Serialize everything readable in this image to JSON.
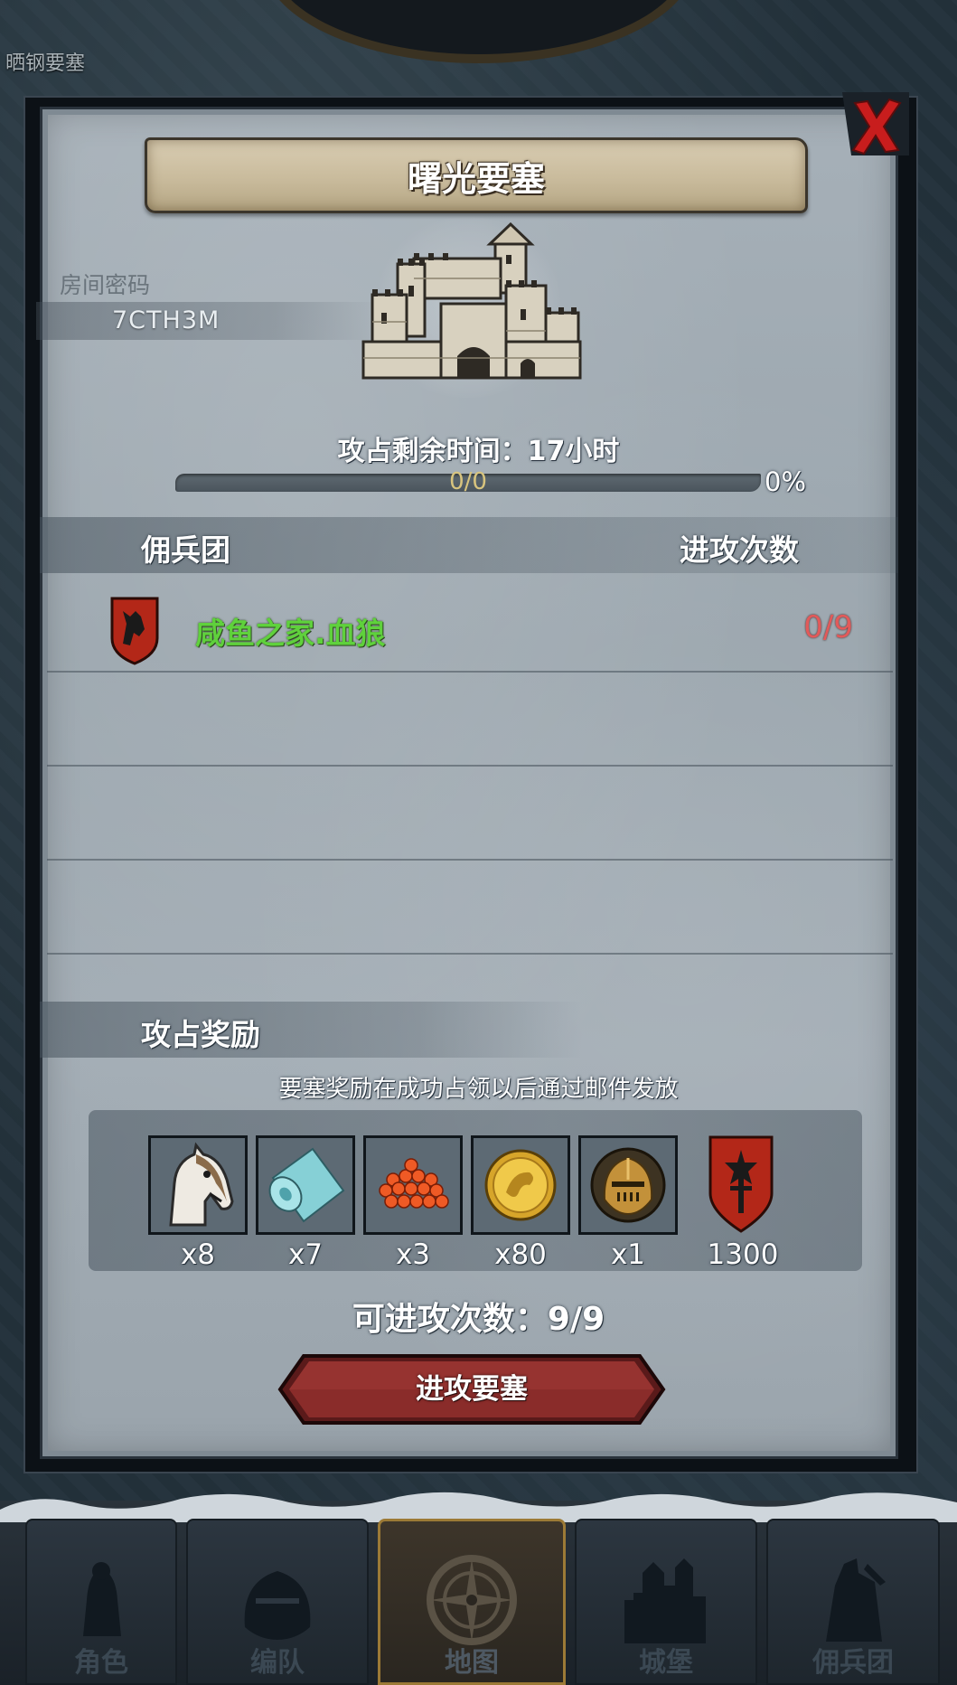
{
  "background": {
    "top_label": "晒钢要塞"
  },
  "modal": {
    "title": "曙光要塞",
    "room_code_label": "房间密码",
    "room_code": "7CTH3M",
    "time_remaining": "攻占剩余时间：17小时",
    "progress": {
      "value_text": "0/0",
      "percent_text": "0%",
      "fraction": 0
    },
    "mercenary_header": {
      "left": "佣兵团",
      "right": "进攻次数"
    },
    "mercenary_rows": [
      {
        "name": "咸鱼之家.血狼",
        "attacks": "0/9",
        "emblem": "wolf-shield-icon"
      },
      {
        "name": "",
        "attacks": ""
      },
      {
        "name": "",
        "attacks": ""
      },
      {
        "name": "",
        "attacks": ""
      }
    ],
    "reward_header": "攻占奖励",
    "reward_note": "要塞奖励在成功占领以后通过邮件发放",
    "rewards": [
      {
        "icon": "horse-head-icon",
        "qty": "x8"
      },
      {
        "icon": "cloth-roll-icon",
        "qty": "x7"
      },
      {
        "icon": "red-beads-icon",
        "qty": "x3"
      },
      {
        "icon": "gold-coin-icon",
        "qty": "x80"
      },
      {
        "icon": "knight-helmet-icon",
        "qty": "x1"
      },
      {
        "icon": "guild-banner-icon",
        "qty": "1300"
      }
    ],
    "attempts_text": "可进攻次数：9/9",
    "attack_button": "进攻要塞"
  },
  "nav": {
    "tabs": [
      {
        "label": "角色",
        "icon": "knight-icon",
        "active": false
      },
      {
        "label": "编队",
        "icon": "helmet-icon",
        "active": false
      },
      {
        "label": "地图",
        "icon": "compass-icon",
        "active": true
      },
      {
        "label": "城堡",
        "icon": "castle-icon",
        "active": false
      },
      {
        "label": "佣兵团",
        "icon": "mercenary-icon",
        "active": false
      }
    ]
  },
  "colors": {
    "member_name": "#5fd13c",
    "attack_count": "#e25a5a",
    "button_red": "#7a2424",
    "nav_active_border": "#9c7a36"
  }
}
